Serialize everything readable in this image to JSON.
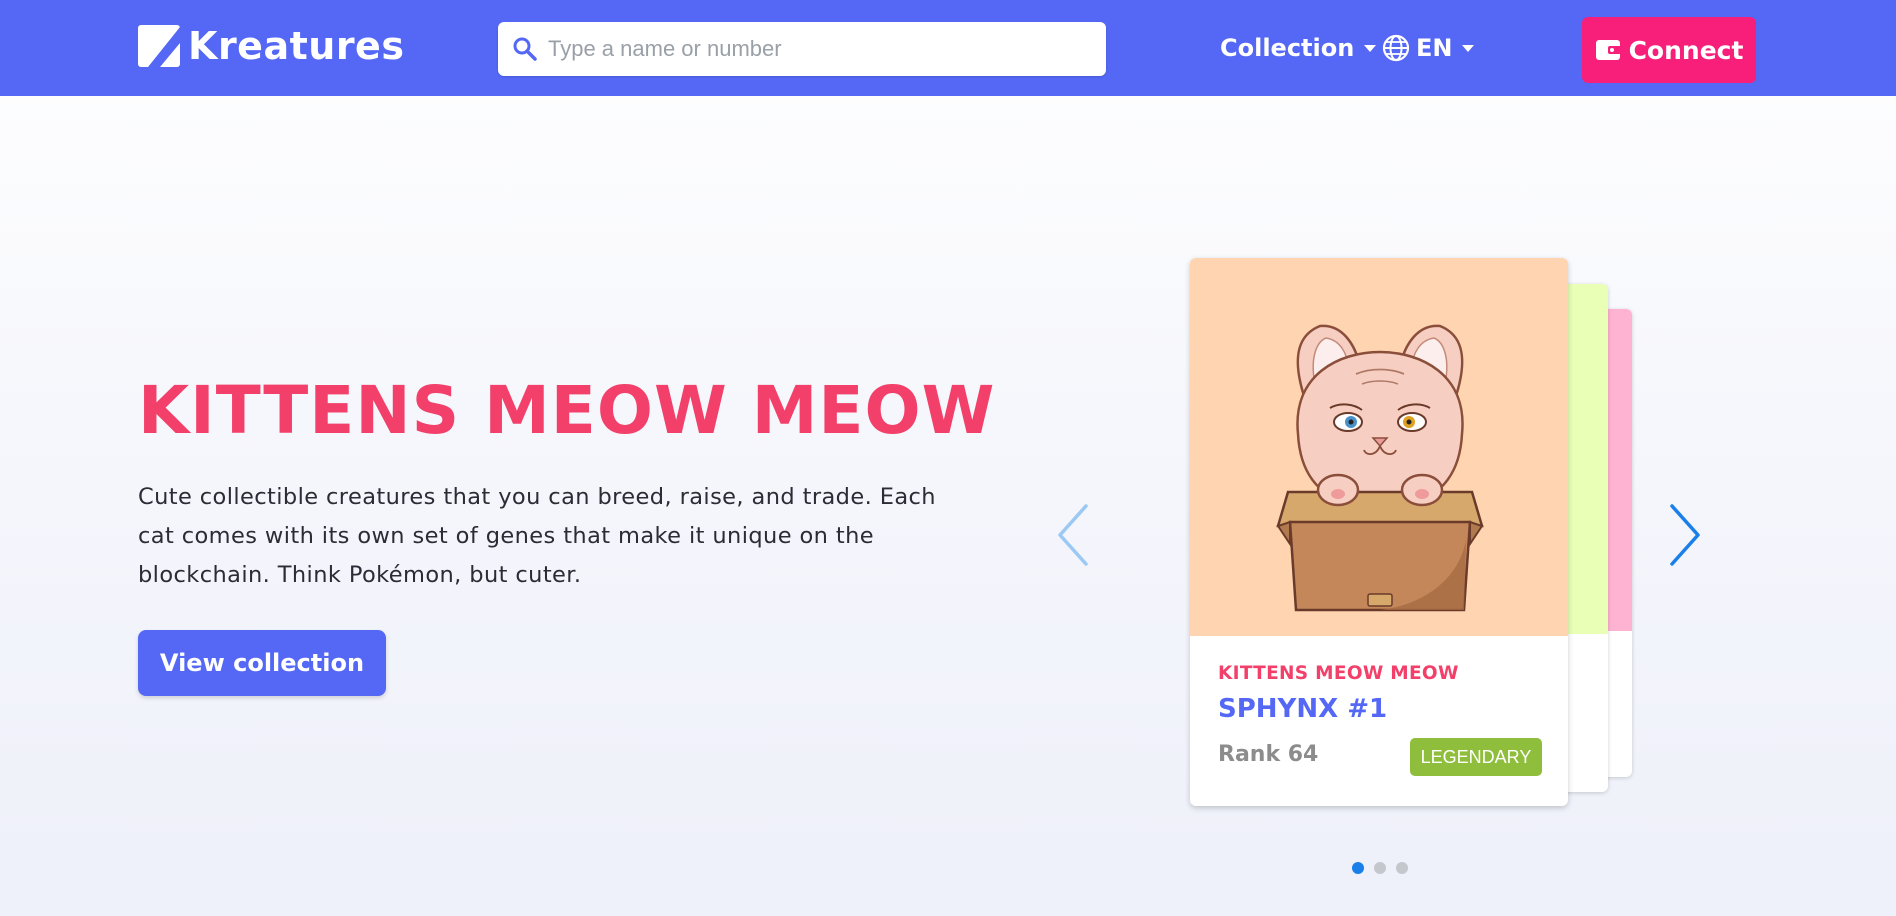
{
  "brand": {
    "name": "Kreatures",
    "logo_icon": "kreatures-logo-icon"
  },
  "search": {
    "placeholder": "Type a name or number",
    "value": "",
    "icon": "search-icon"
  },
  "nav": {
    "collection_label": "Collection",
    "language_label": "EN",
    "language_icon": "globe-icon",
    "connect_label": "Connect",
    "connect_icon": "wallet-icon"
  },
  "hero": {
    "title": "KITTENS MEOW MEOW",
    "description": "Cute collectible creatures that you can breed, raise, and trade. Each cat comes with its own set of genes that make it unique on the blockchain. Think Pokémon, but cuter.",
    "cta_label": "View collection"
  },
  "carousel": {
    "prev_icon": "chevron-left-icon",
    "next_icon": "chevron-right-icon",
    "card": {
      "collection": "KITTENS MEOW MEOW",
      "name": "SPHYNX #1",
      "rank": "Rank 64",
      "badge": "LEGENDARY",
      "image": "sphynx-cat-in-box-image",
      "image_bg": "#ffd4b0"
    },
    "stack_colors": [
      "#e9ffb6",
      "#ffb3d3"
    ],
    "dots_count": 3,
    "active_dot": 1
  },
  "colors": {
    "primary": "#5468f5",
    "accent": "#f2406a",
    "connect": "#f71f7a",
    "badge": "#8fbe3c",
    "active_dot": "#1a7fe8"
  }
}
